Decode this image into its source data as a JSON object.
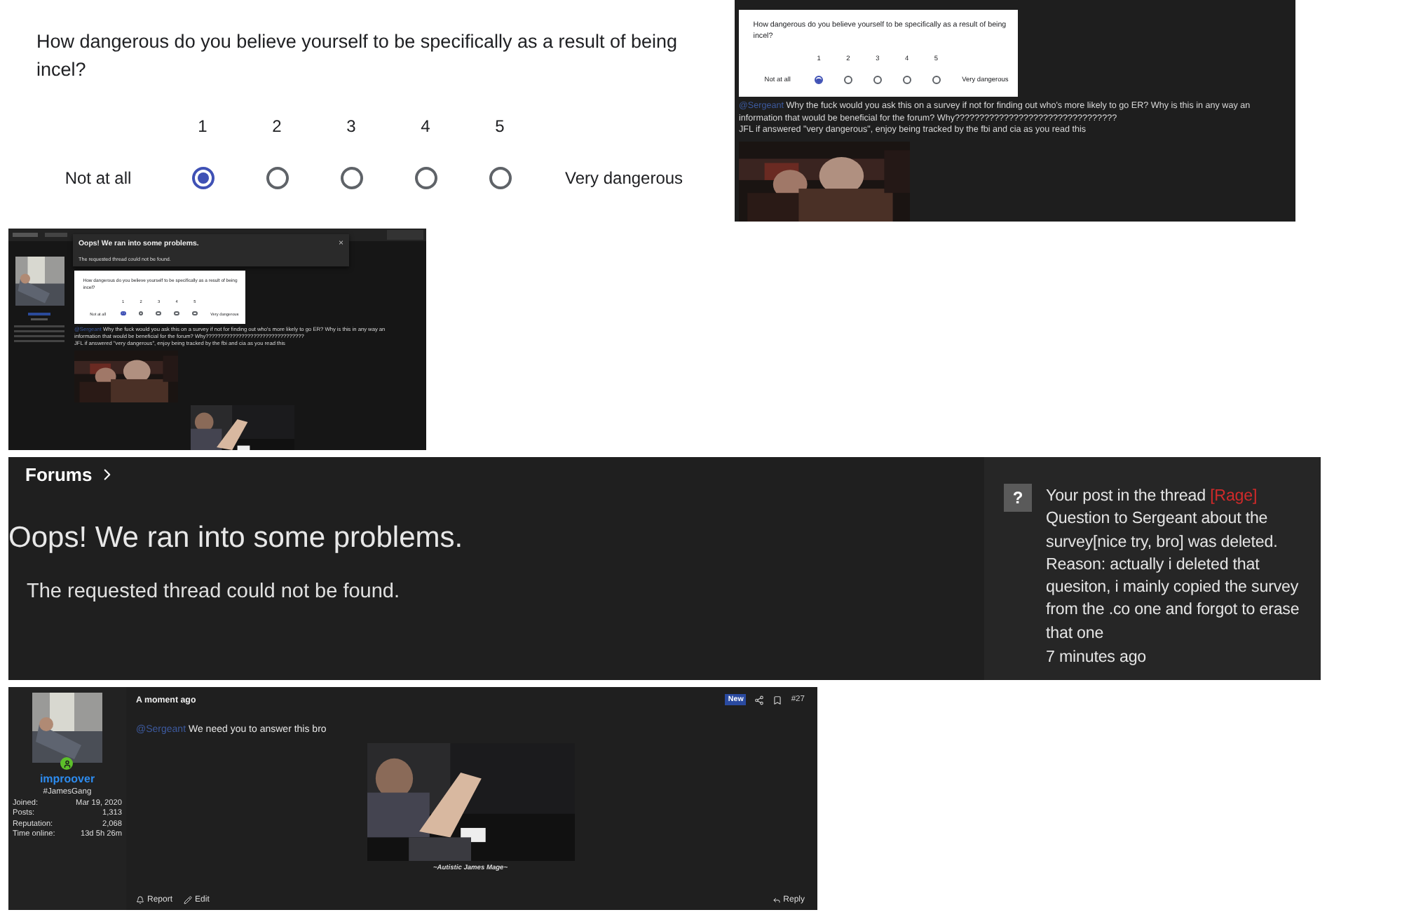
{
  "survey": {
    "question": "How dangerous do you believe yourself to be specifically as a result of being incel?",
    "low_label": "Not at all",
    "high_label": "Very dangerous",
    "options": [
      {
        "label": "1",
        "selected": true
      },
      {
        "label": "2",
        "selected": false
      },
      {
        "label": "3",
        "selected": false
      },
      {
        "label": "4",
        "selected": false
      },
      {
        "label": "5",
        "selected": false
      }
    ]
  },
  "reply_screenshot": {
    "survey": {
      "question": "How dangerous do you believe yourself to be specifically as a result of being incel?",
      "low_label": "Not at all",
      "high_label": "Very dangerous",
      "options": [
        {
          "label": "1",
          "selected": true
        },
        {
          "label": "2",
          "selected": false
        },
        {
          "label": "3",
          "selected": false
        },
        {
          "label": "4",
          "selected": false
        },
        {
          "label": "5",
          "selected": false
        }
      ]
    },
    "mention": "@Sergeant",
    "body": "Why the fuck would you ask this on a survey if not for finding out who's more likely to go ER? Why is this in any way an information that would be beneficial for the forum? Why?????????????????????????????????",
    "last_line": "JFL if answered \"very dangerous\", enjoy being tracked by the fbi and cia as you read this"
  },
  "thumbnail": {
    "dialog": {
      "title": "Oops! We ran into some problems.",
      "message": "The requested thread could not be found.",
      "close": "×"
    },
    "reply": {
      "survey": {
        "question": "How dangerous do you believe yourself to be specifically as a result of being incel?",
        "low_label": "Not at all",
        "high_label": "Very dangerous",
        "options": [
          {
            "label": "1",
            "selected": true
          },
          {
            "label": "2",
            "selected": false
          },
          {
            "label": "3",
            "selected": false
          },
          {
            "label": "4",
            "selected": false
          },
          {
            "label": "5",
            "selected": false
          }
        ]
      },
      "mention": "@Sergeant",
      "body": "Why the fuck would you ask this on a survey if not for finding out who's more likely to go ER? Why is this in any way an information that would be beneficial for the forum? Why?????????????????????????????????",
      "last_line": "JFL if answered \"very dangerous\", enjoy being tracked by the fbi and cia as you read this"
    }
  },
  "error_page": {
    "breadcrumb": "Forums",
    "title": "Oops! We ran into some problems.",
    "message": "The requested thread could not be found.",
    "alert": {
      "icon": "?",
      "prefix": "Your post in the thread",
      "tag": "[Rage]",
      "suffix": "Question to Sergeant about the survey[nice try, bro] was deleted. Reason: actually i deleted that quesiton, i mainly copied the survey from the .co one and forgot to erase that one",
      "time": "7 minutes ago"
    }
  },
  "post": {
    "author": {
      "name": "improover",
      "title": "#JamesGang",
      "online": true,
      "stats": [
        {
          "label": "Joined:",
          "value": "Mar 19, 2020"
        },
        {
          "label": "Posts:",
          "value": "1,313"
        },
        {
          "label": "Reputation:",
          "value": "2,068"
        },
        {
          "label": "Time online:",
          "value": "13d 5h 26m"
        }
      ]
    },
    "time": "A moment ago",
    "badge": "New",
    "number": "#27",
    "mention": "@Sergeant",
    "text": "We need you to answer this bro",
    "caption": "~Autistic James Mage~",
    "actions": [
      {
        "label": "Report",
        "kind": "report"
      },
      {
        "label": "Edit",
        "kind": "edit"
      }
    ],
    "reply": "Reply"
  }
}
